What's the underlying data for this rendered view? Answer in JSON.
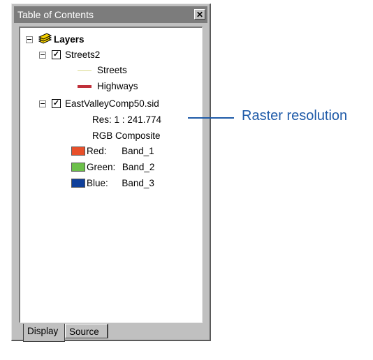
{
  "window": {
    "title": "Table of Contents",
    "close_glyph": "✕"
  },
  "toc": {
    "root_label": "Layers",
    "layers": [
      {
        "name": "Streets2",
        "checked": true,
        "legend": [
          {
            "label": "Streets",
            "color": "#d9d98a",
            "kind": "line-thin"
          },
          {
            "label": "Highways",
            "color": "#c0303a",
            "kind": "line-thick"
          }
        ]
      },
      {
        "name": "EastValleyComp50.sid",
        "checked": true,
        "res": "Res: 1 : 241.774",
        "composite": "RGB Composite",
        "bands": [
          {
            "label": "Red:",
            "band": "Band_1",
            "color": "#e8502a"
          },
          {
            "label": "Green:",
            "band": "Band_2",
            "color": "#6cc04a"
          },
          {
            "label": "Blue:",
            "band": "Band_3",
            "color": "#0f3f9a"
          }
        ]
      }
    ]
  },
  "tabs": [
    {
      "label": "Display",
      "active": true
    },
    {
      "label": "Source",
      "active": false
    }
  ],
  "callout": {
    "text": "Raster resolution",
    "color": "#1e5aa8"
  },
  "icons": {
    "layers_icon": "layers-icon",
    "check_glyph": "✓"
  }
}
